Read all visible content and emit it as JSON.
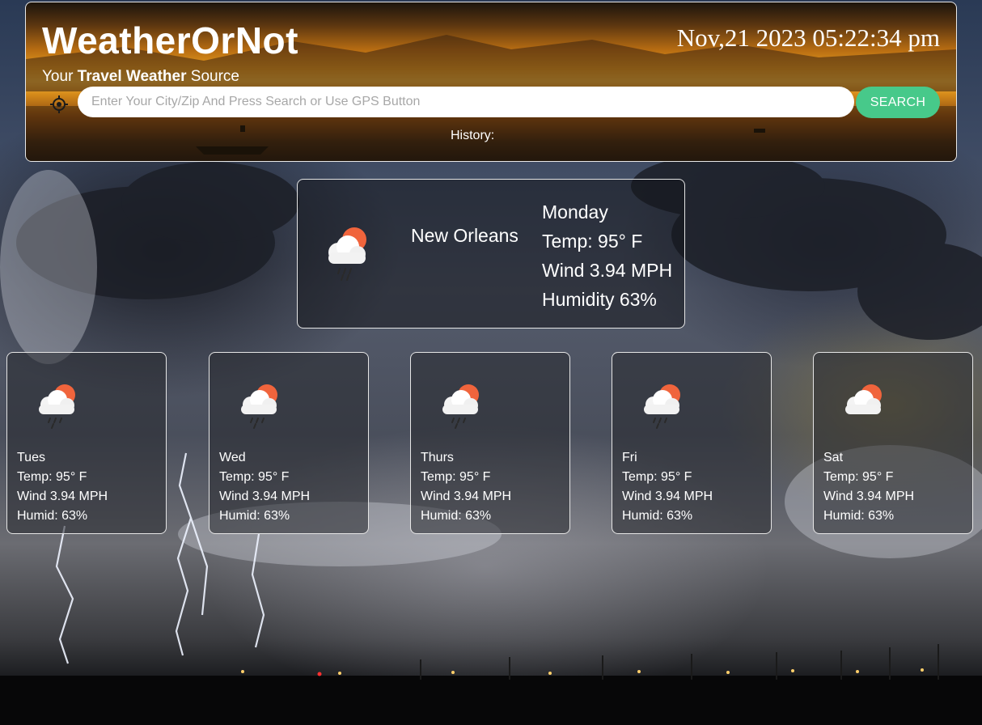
{
  "header": {
    "title": "WeatherOrNot",
    "subtitle_prefix": "Your",
    "subtitle_bold": "Travel Weather",
    "subtitle_suffix": "Source",
    "datetime": "Nov,21 2023 05:22:34 pm",
    "search": {
      "placeholder": "Enter Your City/Zip And Press Search or Use GPS Button",
      "value": "",
      "button_label": "SEARCH"
    },
    "gps_icon": "crosshair-gps-icon",
    "history_label": "History:"
  },
  "current": {
    "icon": "cloud-sun-rain-icon",
    "city": "New Orleans",
    "day": "Monday",
    "temp": "Temp: 95° F",
    "wind": "Wind 3.94 MPH",
    "humidity": "Humidity 63%"
  },
  "forecast": [
    {
      "day": "Tues",
      "temp": "Temp: 95° F",
      "wind": "Wind 3.94 MPH",
      "humid": "Humid: 63%",
      "icon": "cloud-sun-rain-icon"
    },
    {
      "day": "Wed",
      "temp": "Temp: 95° F",
      "wind": "Wind 3.94 MPH",
      "humid": "Humid: 63%",
      "icon": "cloud-sun-rain-icon"
    },
    {
      "day": "Thurs",
      "temp": "Temp: 95° F",
      "wind": "Wind 3.94 MPH",
      "humid": "Humid: 63%",
      "icon": "cloud-sun-rain-icon"
    },
    {
      "day": "Fri",
      "temp": "Temp: 95° F",
      "wind": "Wind 3.94 MPH",
      "humid": "Humid: 63%",
      "icon": "cloud-sun-rain-icon"
    },
    {
      "day": "Sat",
      "temp": "Temp: 95° F",
      "wind": "Wind 3.94 MPH",
      "humid": "Humid: 63%",
      "icon": "cloud-sun-icon"
    }
  ],
  "colors": {
    "search_button": "#47c98a",
    "sun": "#f0643c"
  }
}
